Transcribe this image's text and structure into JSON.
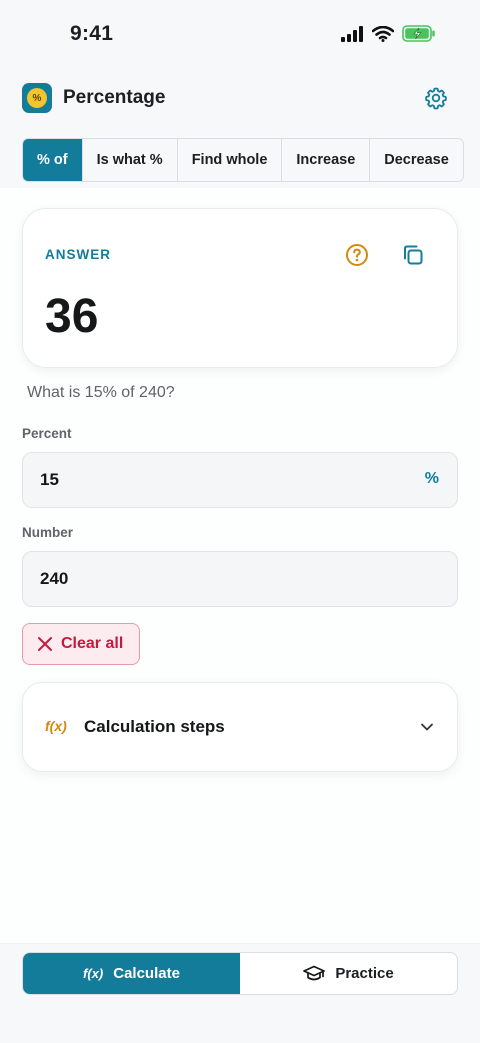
{
  "status_bar": {
    "time": "9:41"
  },
  "header": {
    "title": "Percentage",
    "logo_glyph": "%"
  },
  "tabs": [
    {
      "label": "% of",
      "active": true
    },
    {
      "label": "Is what %",
      "active": false
    },
    {
      "label": "Find whole",
      "active": false
    },
    {
      "label": "Increase",
      "active": false
    },
    {
      "label": "Decrease",
      "active": false
    }
  ],
  "answer": {
    "label": "ANSWER",
    "value": "36"
  },
  "question": "What is 15% of 240?",
  "inputs": {
    "percent": {
      "label": "Percent",
      "value": "15",
      "suffix": "%"
    },
    "number": {
      "label": "Number",
      "value": "240"
    }
  },
  "clear_button": "Clear all",
  "steps": {
    "icon_text": "f(x)",
    "title": "Calculation steps"
  },
  "bottom_nav": {
    "calculate": {
      "icon_text": "f(x)",
      "label": "Calculate",
      "active": true
    },
    "practice": {
      "label": "Practice",
      "active": false
    }
  },
  "colors": {
    "accent": "#137c9b",
    "danger": "#c21b3f",
    "warning": "#d08a12",
    "logo_coin": "#f0c52e"
  }
}
